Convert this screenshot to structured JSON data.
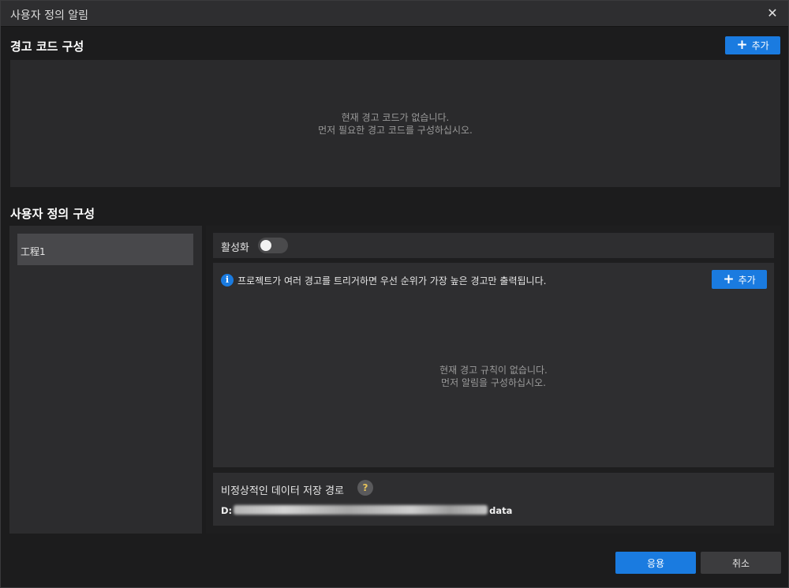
{
  "window": {
    "title": "사용자 정의 알림",
    "close_icon": "close-icon",
    "close_glyph": "✕"
  },
  "warning_codes": {
    "title": "경고 코드 구성",
    "add_label": "추가",
    "empty_line1": "현재 경고 코드가 없습니다.",
    "empty_line2": "먼저 필요한 경고 코드를 구성하십시오."
  },
  "custom_config": {
    "title": "사용자 정의 구성",
    "projects": [
      {
        "label": "工程1"
      }
    ],
    "activate_label": "활성화",
    "activate_state": false,
    "rules": {
      "info_text": "프로젝트가 여러 경고를 트리거하면 우선 순위가 가장 높은 경고만 출력됩니다.",
      "add_label": "추가",
      "empty_line1": "현재 경고 규칙이 없습니다.",
      "empty_line2": "먼저 알림을 구성하십시오."
    },
    "abnormal_path": {
      "label": "비정상적인 데이터 저장 경로",
      "help_glyph": "?",
      "value_prefix": "D:",
      "value_suffix": "data"
    }
  },
  "footer": {
    "apply_label": "응용",
    "cancel_label": "취소"
  },
  "colors": {
    "accent": "#1a7be0",
    "background": "#1c1c1d",
    "panel": "#2e2e30"
  }
}
